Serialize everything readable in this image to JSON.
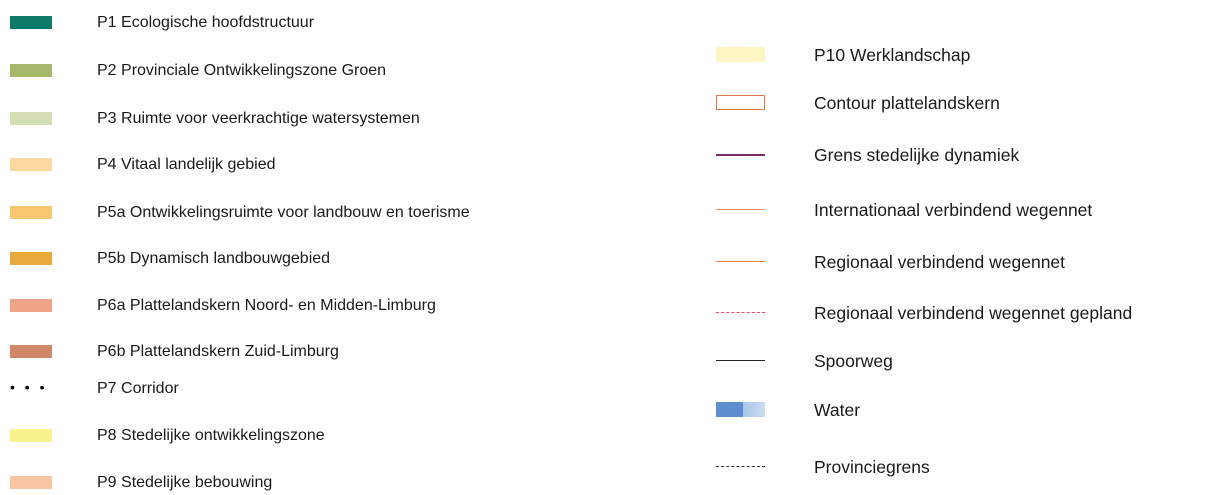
{
  "legend_left": [
    {
      "label": "P1 Ecologische hoofdstructuur",
      "symbol": "fill",
      "color": "#0e7a67"
    },
    {
      "label": "P2 Provinciale Ontwikkelingszone Groen",
      "symbol": "fill",
      "color": "#a6b86c"
    },
    {
      "label": "P3 Ruimte voor veerkrachtige watersystemen",
      "symbol": "fill",
      "color": "#d4dfb3"
    },
    {
      "label": "P4 Vitaal landelijk gebied",
      "symbol": "fill",
      "color": "#fbd9a0"
    },
    {
      "label": "P5a Ontwikkelingsruimte voor landbouw en toerisme",
      "symbol": "fill",
      "color": "#f7c671"
    },
    {
      "label": "P5b Dynamisch landbouwgebied",
      "symbol": "fill",
      "color": "#e8aa3c"
    },
    {
      "label": "P6a Plattelandskern Noord- en Midden-Limburg",
      "symbol": "fill",
      "color": "#f2a588"
    },
    {
      "label": "P6b Plattelandskern Zuid-Limburg",
      "symbol": "fill",
      "color": "#d2876a"
    },
    {
      "label": "P7 Corridor",
      "symbol": "dots",
      "color": "#000000"
    },
    {
      "label": "P8 Stedelijke ontwikkelingszone",
      "symbol": "fill",
      "color": "#faf28c"
    },
    {
      "label": "P9 Stedelijke bebouwing",
      "symbol": "fill",
      "color": "#f8c5a3"
    }
  ],
  "legend_right": [
    {
      "label": "P10 Werklandschap",
      "symbol": "fill",
      "color": "#fcf6c3"
    },
    {
      "label": "Contour plattelandskern",
      "symbol": "outline",
      "color": "#e07a4a"
    },
    {
      "label": "Grens stedelijke dynamiek",
      "symbol": "line",
      "color": "#7b2a6e",
      "style": "solid-thick"
    },
    {
      "label": "Internationaal verbindend wegennet",
      "symbol": "line",
      "color": "#f08a5d",
      "style": "solid"
    },
    {
      "label": "Regionaal verbindend wegennet",
      "symbol": "line",
      "color": "#f07d45",
      "style": "solid"
    },
    {
      "label": "Regionaal verbindend wegennet gepland",
      "symbol": "line",
      "color": "#e84a52",
      "style": "dashed"
    },
    {
      "label": "Spoorweg",
      "symbol": "line",
      "color": "#222222",
      "style": "solid"
    },
    {
      "label": "Water",
      "symbol": "water",
      "color": "#5d8fcf"
    },
    {
      "label": "Provinciegrens",
      "symbol": "line",
      "color": "#333333",
      "style": "dashdot"
    }
  ]
}
